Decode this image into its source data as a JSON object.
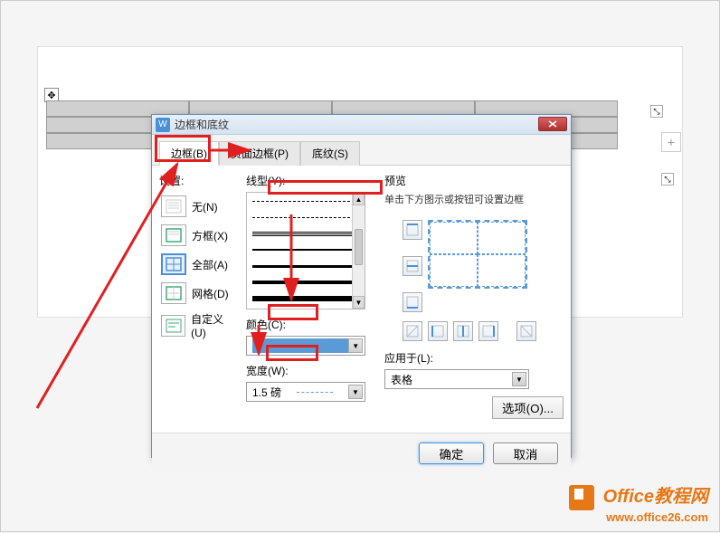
{
  "dialog": {
    "title": "边框和底纹",
    "tabs": {
      "border": "边框(B)",
      "page_border": "页面边框(P)",
      "shading": "底纹(S)"
    },
    "settings_label": "设置:",
    "presets": {
      "none": "无(N)",
      "box": "方框(X)",
      "all": "全部(A)",
      "grid": "网格(D)",
      "custom": "自定义(U)"
    },
    "style_label": "线型(Y):",
    "color_label": "颜色(C):",
    "width_label": "宽度(W):",
    "width_value": "1.5 磅",
    "preview_label": "预览",
    "preview_hint": "单击下方图示或按钮可设置边框",
    "apply_label": "应用于(L):",
    "apply_value": "表格",
    "options_btn": "选项(O)...",
    "ok": "确定",
    "cancel": "取消",
    "color_value": "#5b9bd5"
  },
  "watermark": {
    "brand": "Office教程网",
    "url": "www.office26.com"
  }
}
